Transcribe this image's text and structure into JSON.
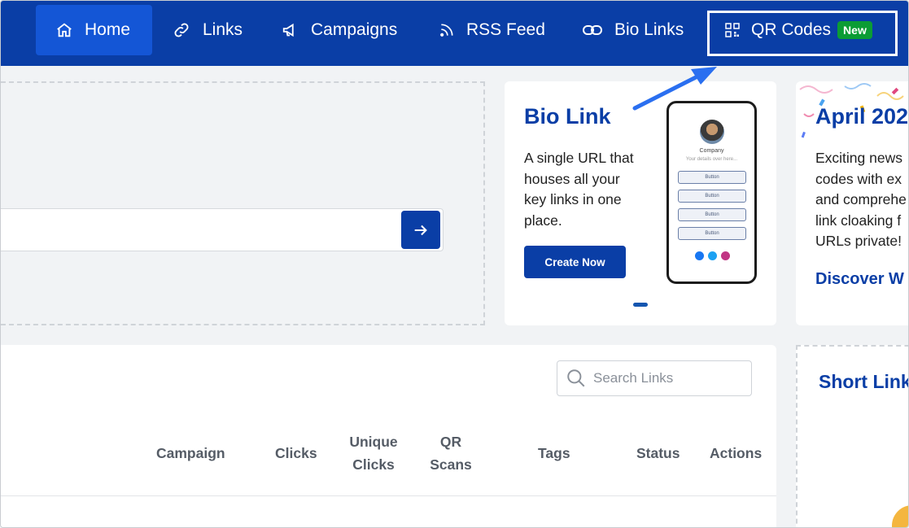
{
  "nav": {
    "home": "Home",
    "links": "Links",
    "campaigns": "Campaigns",
    "rss": "RSS Feed",
    "bio": "Bio Links",
    "qr": "QR Codes",
    "qr_badge": "New"
  },
  "bio_card": {
    "title": "Bio Link",
    "lines": [
      "A single URL that",
      "houses all your",
      "key links in one",
      "place."
    ],
    "button": "Create Now",
    "phone": {
      "company": "Company",
      "subtitle": "Your details over here...",
      "buttons": [
        "Button",
        "Button",
        "Button",
        "Button"
      ]
    }
  },
  "announcement": {
    "title": "April 202",
    "lines": [
      "Exciting news",
      "codes with ex",
      "and comprehe",
      "link cloaking f",
      "URLs private!"
    ],
    "link": "Discover W"
  },
  "table": {
    "search_placeholder": "Search Links",
    "headers": {
      "campaign": "Campaign",
      "clicks": "Clicks",
      "unique1": "Unique",
      "unique2": "Clicks",
      "qr1": "QR",
      "qr2": "Scans",
      "tags": "Tags",
      "status": "Status",
      "actions": "Actions"
    }
  },
  "short_panel": {
    "title": "Short Link"
  },
  "colors": {
    "brand": "#0a3ea6",
    "nav_active": "#1456d6",
    "badge": "#0b9c34"
  }
}
